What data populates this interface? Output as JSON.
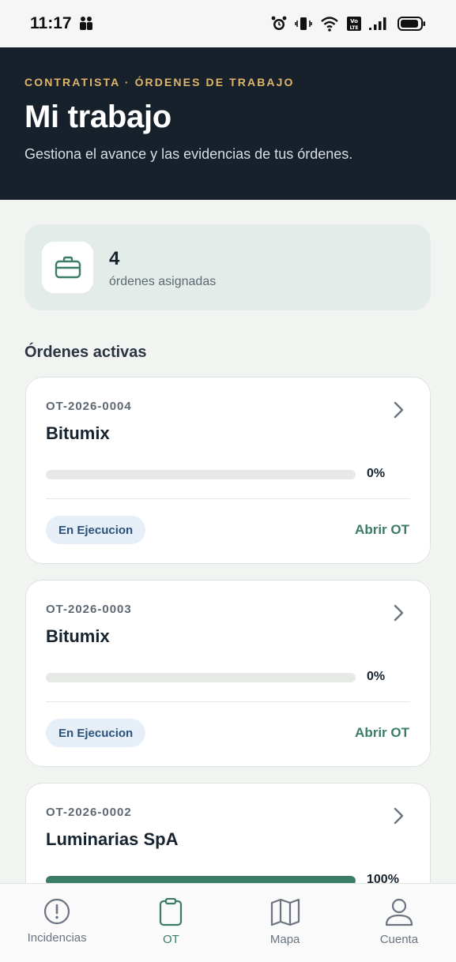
{
  "status_bar": {
    "time": "11:17",
    "battery_icon": "battery-icon",
    "signal_icon": "signal-icon",
    "wifi_icon": "wifi-icon",
    "volte_label": "VoLTE"
  },
  "header": {
    "eyebrow": "CONTRATISTA · ÓRDENES DE TRABAJO",
    "title": "Mi trabajo",
    "subtitle": "Gestiona el avance y las evidencias de tus órdenes."
  },
  "summary": {
    "icon": "briefcase-icon",
    "count": "4",
    "label": "órdenes asignadas"
  },
  "section_title": "Órdenes activas",
  "orders": [
    {
      "code": "OT-2026-0004",
      "name": "Bitumix",
      "progress": 0,
      "progress_label": "0%",
      "status": "En Ejecucion",
      "action": "Abrir OT"
    },
    {
      "code": "OT-2026-0003",
      "name": "Bitumix",
      "progress": 0,
      "progress_label": "0%",
      "status": "En Ejecucion",
      "action": "Abrir OT"
    },
    {
      "code": "OT-2026-0002",
      "name": "Luminarias SpA",
      "progress": 100,
      "progress_label": "100%",
      "status": "",
      "action": ""
    }
  ],
  "nav": {
    "items": [
      {
        "label": "Incidencias",
        "icon": "alert-circle-icon",
        "active": false
      },
      {
        "label": "OT",
        "icon": "clipboard-icon",
        "active": true
      },
      {
        "label": "Mapa",
        "icon": "map-icon",
        "active": false
      },
      {
        "label": "Cuenta",
        "icon": "user-icon",
        "active": false
      }
    ]
  },
  "colors": {
    "header_bg": "#16212c",
    "accent_green": "#3b7c67",
    "eyebrow_gold": "#e0b56a",
    "badge_bg": "#e6eef8",
    "badge_text": "#2c527b"
  }
}
